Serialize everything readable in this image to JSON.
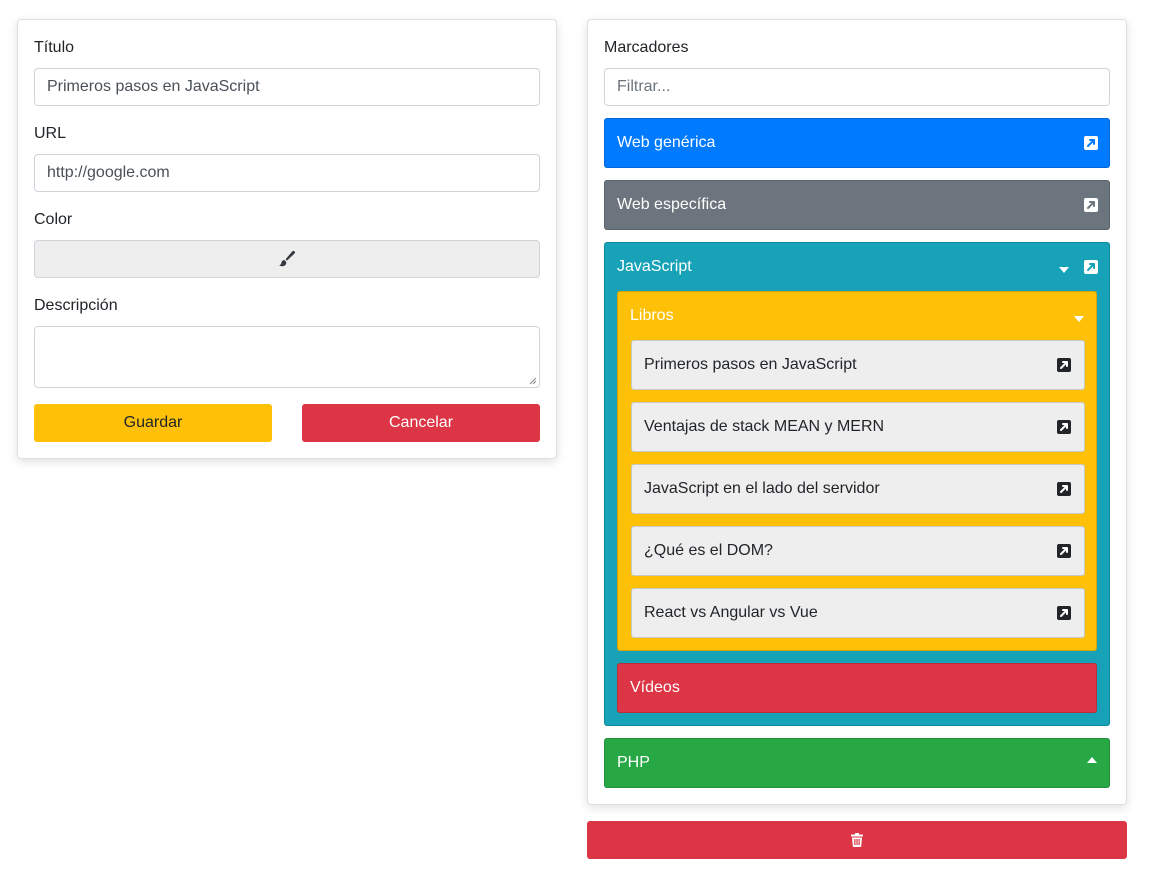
{
  "form": {
    "titulo_label": "Título",
    "titulo_value": "Primeros pasos en JavaScript",
    "url_label": "URL",
    "url_value": "http://google.com",
    "color_label": "Color",
    "color_icon": "paintbrush-icon",
    "descripcion_label": "Descripción",
    "descripcion_value": "",
    "save_label": "Guardar",
    "cancel_label": "Cancelar"
  },
  "bookmarks": {
    "title": "Marcadores",
    "filter_placeholder": "Filtrar...",
    "groups": [
      {
        "label": "Web genérica",
        "color": "#007bff",
        "icon": "external-link-icon"
      },
      {
        "label": "Web específica",
        "color": "#6c757d",
        "icon": "external-link-icon"
      },
      {
        "label": "JavaScript",
        "color": "#17a2b8",
        "expanded": true,
        "children": [
          {
            "label": "Libros",
            "color": "#ffc107",
            "expanded": true,
            "items": [
              {
                "label": "Primeros pasos en JavaScript",
                "icon": "external-link-icon"
              },
              {
                "label": "Ventajas de stack MEAN y MERN",
                "icon": "external-link-icon"
              },
              {
                "label": "JavaScript en el lado del servidor",
                "icon": "external-link-icon"
              },
              {
                "label": "¿Qué es el DOM?",
                "icon": "external-link-icon"
              },
              {
                "label": "React vs Angular vs Vue",
                "icon": "external-link-icon"
              }
            ]
          },
          {
            "label": "Vídeos",
            "color": "#dc3545"
          }
        ]
      },
      {
        "label": "PHP",
        "color": "#28a745",
        "expanded": false
      }
    ],
    "delete_icon": "trash-icon",
    "delete_color": "#dc3545"
  }
}
